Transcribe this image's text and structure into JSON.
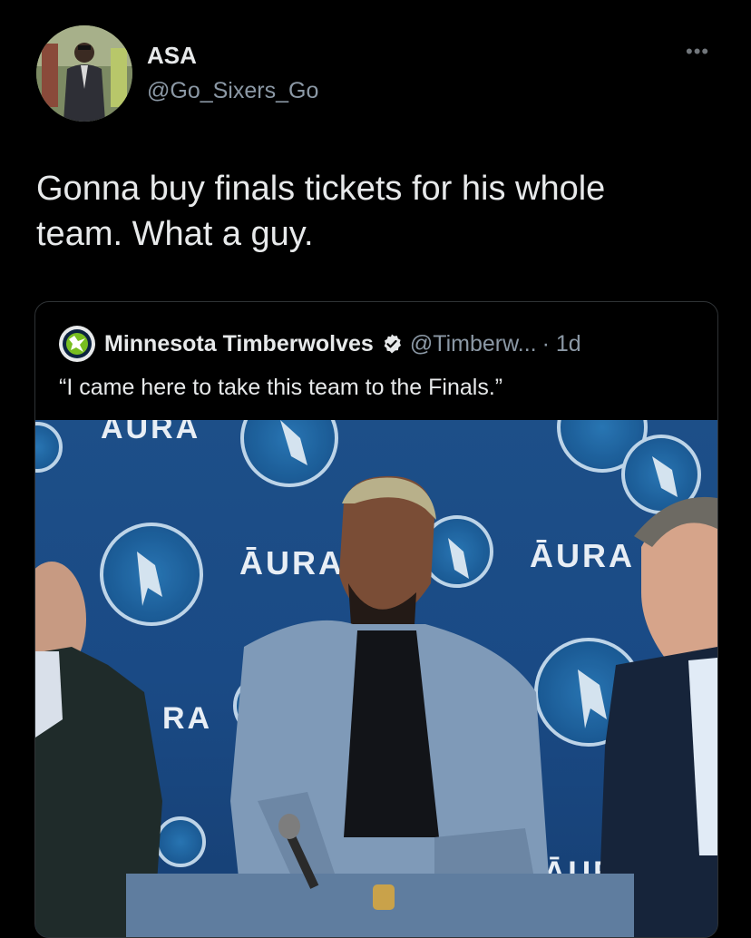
{
  "tweet": {
    "author": {
      "display_name": "ASA",
      "handle": "@Go_Sixers_Go"
    },
    "more_icon": "more-horizontal-icon",
    "text_line1": "Gonna buy finals tickets for his whole",
    "text_line2": "team. What a guy."
  },
  "quoted_tweet": {
    "author": {
      "display_name": "Minnesota Timberwolves",
      "verified": true,
      "handle": "@Timberw...",
      "time": "· 1d"
    },
    "text": "“I came here to take this team to the Finals.”",
    "photo": {
      "sponsor_text": "ĀURA",
      "backdrop_color": "#1d4f88"
    }
  },
  "colors": {
    "background": "#000000",
    "text_primary": "#e7e9ea",
    "text_secondary": "#8b98a5",
    "card_border": "#2f3336"
  }
}
